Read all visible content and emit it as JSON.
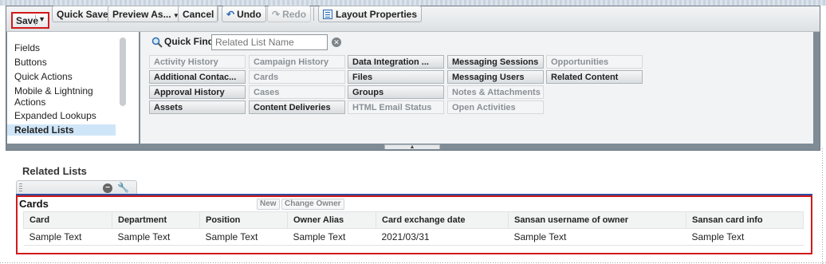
{
  "toolbar": {
    "save": "Save",
    "quick_save": "Quick Save",
    "preview_as": "Preview As...",
    "cancel": "Cancel",
    "undo": "Undo",
    "redo": "Redo",
    "layout_properties": "Layout Properties"
  },
  "left_tabs": [
    "Fields",
    "Buttons",
    "Quick Actions",
    "Mobile & Lightning Actions",
    "Expanded Lookups",
    "Related Lists"
  ],
  "selected_tab": "Related Lists",
  "quick_find": {
    "label": "Quick Find",
    "placeholder": "Related List Name"
  },
  "palette_items": [
    {
      "label": "Activity History",
      "used": true
    },
    {
      "label": "Campaign History",
      "used": true
    },
    {
      "label": "Data Integration ...",
      "used": false
    },
    {
      "label": "Messaging Sessions",
      "used": false
    },
    {
      "label": "Opportunities",
      "used": true
    },
    {
      "label": "Additional Contac...",
      "used": false
    },
    {
      "label": "Cards",
      "used": true
    },
    {
      "label": "Files",
      "used": false
    },
    {
      "label": "Messaging Users",
      "used": false
    },
    {
      "label": "Related Content",
      "used": false
    },
    {
      "label": "Approval History",
      "used": false
    },
    {
      "label": "Cases",
      "used": true
    },
    {
      "label": "Groups",
      "used": false
    },
    {
      "label": "Notes & Attachments",
      "used": true
    },
    {
      "label": "Assets",
      "used": false
    },
    {
      "label": "Content Deliveries",
      "used": false
    },
    {
      "label": "HTML Email Status",
      "used": true
    },
    {
      "label": "Open Activities",
      "used": true
    }
  ],
  "related_lists_heading": "Related Lists",
  "cards_section": {
    "title": "Cards",
    "buttons": [
      "New",
      "Change Owner"
    ],
    "columns": [
      "Card",
      "Department",
      "Position",
      "Owner Alias",
      "Card exchange date",
      "Sansan username of owner",
      "Sansan card info"
    ],
    "rows": [
      [
        "Sample Text",
        "Sample Text",
        "Sample Text",
        "Sample Text",
        "2021/03/31",
        "Sample Text",
        "Sample Text"
      ]
    ]
  },
  "colors": {
    "highlight_border": "#d11a1a",
    "selected_tab_bg": "#cfe6f8",
    "accent_blue": "#2c4ba0"
  }
}
